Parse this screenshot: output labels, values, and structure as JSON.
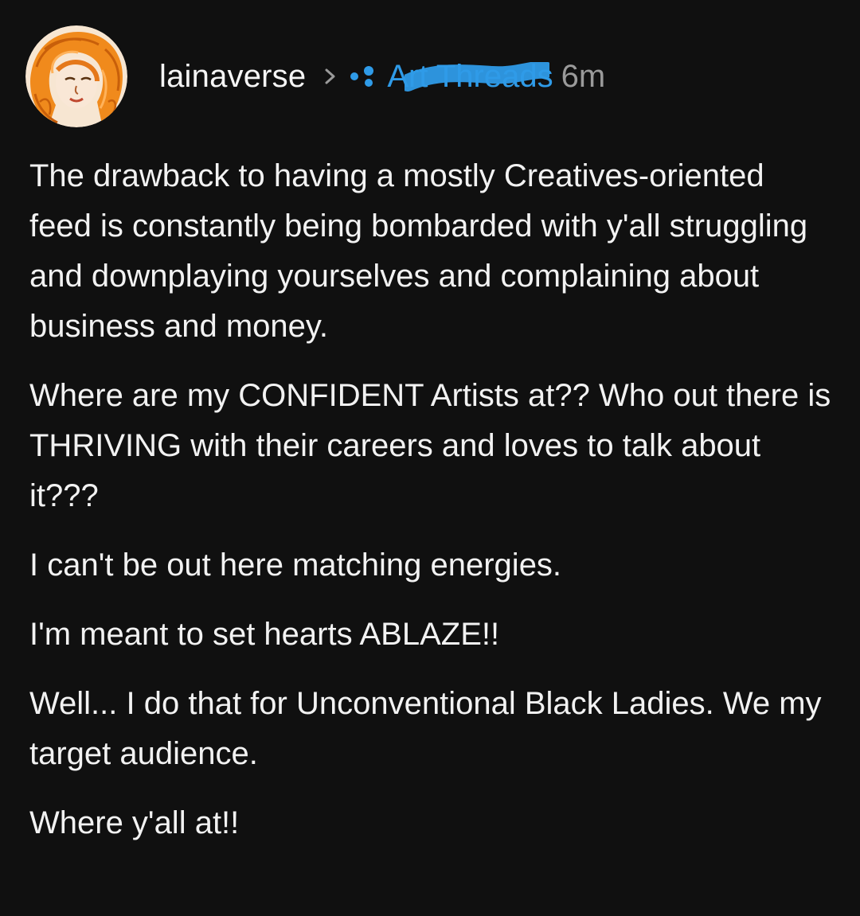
{
  "post": {
    "author": "lainaverse",
    "community": {
      "name": "Art Threads",
      "color": "#2f9be8"
    },
    "time": "6m",
    "paragraphs": [
      "The drawback to having a mostly Creatives-oriented feed is constantly being bombarded with y'all struggling and downplaying yourselves and complaining about business and money.",
      "Where are my CONFIDENT Artists at?? Who out there is THRIVING with their careers and loves to talk about it???",
      "I can't be out here matching energies.",
      "I'm meant to set hearts ABLAZE!!",
      "Well... I do that for Unconventional Black Ladies. We my target audience.",
      "Where y'all at!!"
    ]
  },
  "icons": {
    "avatar": "avatar-illustration",
    "separator": "chevron-right-icon",
    "community": "community-dots-icon"
  },
  "colors": {
    "background": "#101010",
    "text": "#f2f2f2",
    "muted": "#9a9a9a",
    "accent": "#2f9be8"
  }
}
